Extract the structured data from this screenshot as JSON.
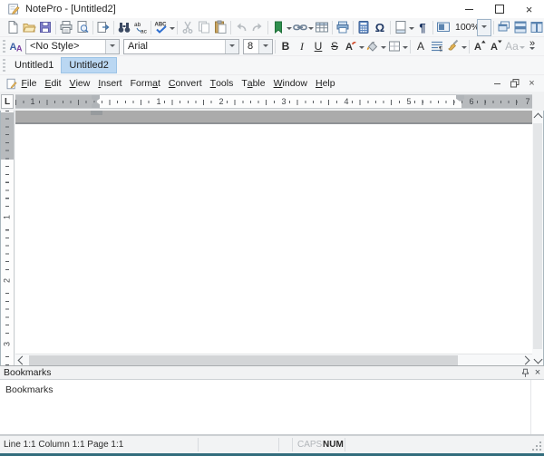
{
  "window": {
    "title": "NotePro - [Untitled2]"
  },
  "menubar": {
    "items": [
      {
        "pre": "",
        "accel": "F",
        "post": "ile"
      },
      {
        "pre": "",
        "accel": "E",
        "post": "dit"
      },
      {
        "pre": "",
        "accel": "V",
        "post": "iew"
      },
      {
        "pre": "",
        "accel": "I",
        "post": "nsert"
      },
      {
        "pre": "Form",
        "accel": "a",
        "post": "t"
      },
      {
        "pre": "",
        "accel": "C",
        "post": "onvert"
      },
      {
        "pre": "",
        "accel": "T",
        "post": "ools"
      },
      {
        "pre": "T",
        "accel": "a",
        "post": "ble"
      },
      {
        "pre": "",
        "accel": "W",
        "post": "indow"
      },
      {
        "pre": "",
        "accel": "H",
        "post": "elp"
      }
    ]
  },
  "tabs": [
    {
      "label": "Untitled1",
      "active": false
    },
    {
      "label": "Untitled2",
      "active": true
    }
  ],
  "toolbar_main": {
    "zoom_value": "100%"
  },
  "toolbar_format": {
    "style_value": "<No Style>",
    "font_value": "Arial",
    "size_value": "8"
  },
  "glyphs": {
    "spellcheck_text": "ABC",
    "replace_top": "ab",
    "replace_bottom": "ac",
    "omega": "Ω",
    "pilcrow": "¶",
    "style_a1": "A",
    "style_a2": "A",
    "bold": "B",
    "italic": "I",
    "underline": "U",
    "strikethrough": "S",
    "font_color": "A",
    "font_dialog": "A",
    "paragraph_mark": "¶",
    "grow_font": "A",
    "shrink_font": "A",
    "change_case": "Aa",
    "overflow_chevron": "»",
    "tab_selector": "L",
    "close": "×",
    "mdi_close": "×",
    "panel_close": "×"
  },
  "ruler": {
    "h_left_margin_label": "1",
    "h_numbers": [
      "1",
      "2",
      "3",
      "4",
      "5"
    ],
    "h_right_labels": [
      "6",
      "7"
    ],
    "v_numbers": [
      "1",
      "2",
      "3"
    ]
  },
  "bookmarks": {
    "panel_title": "Bookmarks",
    "list_header": "Bookmarks"
  },
  "statusbar": {
    "position": "Line 1:1 Column 1:1 Page 1:1",
    "caps": "CAPS",
    "num": "NUM"
  },
  "colors": {
    "active_tab_bg": "#bad7f2",
    "bookmark_green": "#2f8f4e",
    "save_purple": "#8585cf",
    "spellcheck_blue": "#2f6fd0",
    "toolbar_blue": "#5b84b0",
    "bottom_edge": "#336d7d"
  }
}
